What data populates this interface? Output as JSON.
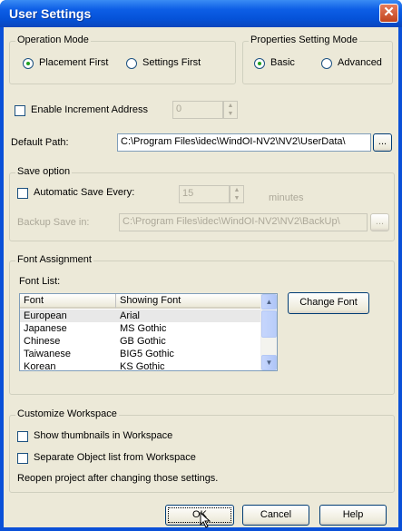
{
  "window": {
    "title": "User Settings",
    "close_symbol": "✕"
  },
  "operation_mode": {
    "label": "Operation Mode",
    "options": [
      "Placement First",
      "Settings First"
    ],
    "selected": "Placement First"
  },
  "properties_mode": {
    "label": "Properties Setting Mode",
    "options": [
      "Basic",
      "Advanced"
    ],
    "selected": "Basic"
  },
  "increment": {
    "label": "Enable Increment Address",
    "checked": false,
    "value": "0"
  },
  "default_path": {
    "label": "Default Path:",
    "value": "C:\\Program Files\\idec\\WindOI-NV2\\NV2\\UserData\\",
    "browse_label": "..."
  },
  "save_option": {
    "label": "Save option",
    "auto_save_label": "Automatic Save Every:",
    "auto_save_checked": false,
    "interval": "15",
    "unit": "minutes",
    "backup_label": "Backup Save in:",
    "backup_path": "C:\\Program Files\\idec\\WindOI-NV2\\NV2\\BackUp\\",
    "browse_label": "..."
  },
  "font_assignment": {
    "label": "Font Assignment",
    "list_label": "Font List:",
    "columns": [
      "Font",
      "Showing Font"
    ],
    "rows": [
      {
        "font": "European",
        "showing": "Arial"
      },
      {
        "font": "Japanese",
        "showing": "MS Gothic"
      },
      {
        "font": "Chinese",
        "showing": "GB Gothic"
      },
      {
        "font": "Taiwanese",
        "showing": "BIG5 Gothic"
      },
      {
        "font": "Korean",
        "showing": "KS Gothic"
      }
    ],
    "selected_row": "European",
    "change_button": "Change Font"
  },
  "workspace": {
    "label": "Customize Workspace",
    "show_thumbnails": "Show thumbnails in Workspace",
    "separate_list": "Separate Object list from Workspace",
    "note": "Reopen project after changing those settings."
  },
  "buttons": {
    "ok": "OK",
    "cancel": "Cancel",
    "help": "Help"
  },
  "colors": {
    "titlebar": "#0552d8",
    "client": "#ece9d8",
    "radio_dot": "#21a121",
    "selected_row": "#e8e8e8"
  }
}
